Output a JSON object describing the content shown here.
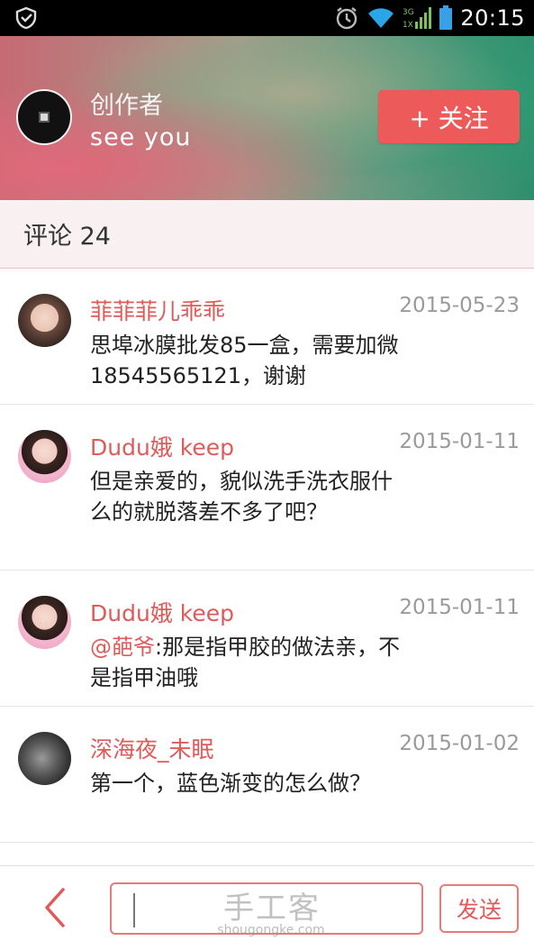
{
  "status_bar": {
    "time": "20:15",
    "network_label": "3G",
    "network_sub": "1X",
    "icons": [
      "shield-icon",
      "alarm-icon",
      "wifi-icon",
      "signal-icon",
      "battery-icon"
    ],
    "battery_color": "#3aa0e6"
  },
  "creator": {
    "label": "创作者",
    "name": "see  you",
    "follow_label": "+ 关注"
  },
  "comments_header": {
    "label": "评论 24"
  },
  "comments": [
    {
      "name": "菲菲菲儿乖乖",
      "date": "2015-05-23",
      "text": "思埠冰膜批发85一盒，需要加微18545565121，谢谢"
    },
    {
      "name": "Dudu娥 keep",
      "date": "2015-01-11",
      "text": "但是亲爱的，貌似洗手洗衣服什么的就脱落差不多了吧？"
    },
    {
      "name": "Dudu娥 keep",
      "date": "2015-01-11",
      "mention": "@葩爷",
      "text": ":那是指甲胶的做法亲，不是指甲油哦"
    },
    {
      "name": "深海夜_未眠",
      "date": "2015-01-02",
      "text": "第一个，蓝色渐变的怎么做？"
    }
  ],
  "bottom_bar": {
    "input_placeholder": "",
    "send_label": "发送"
  },
  "watermark": {
    "text": "手工客",
    "url": "shougongke.com"
  },
  "colors": {
    "accent": "#ec5a5a",
    "name_red": "#e05a5a",
    "date_gray": "#9a9a9a",
    "header_band": "#f9f1f1"
  }
}
